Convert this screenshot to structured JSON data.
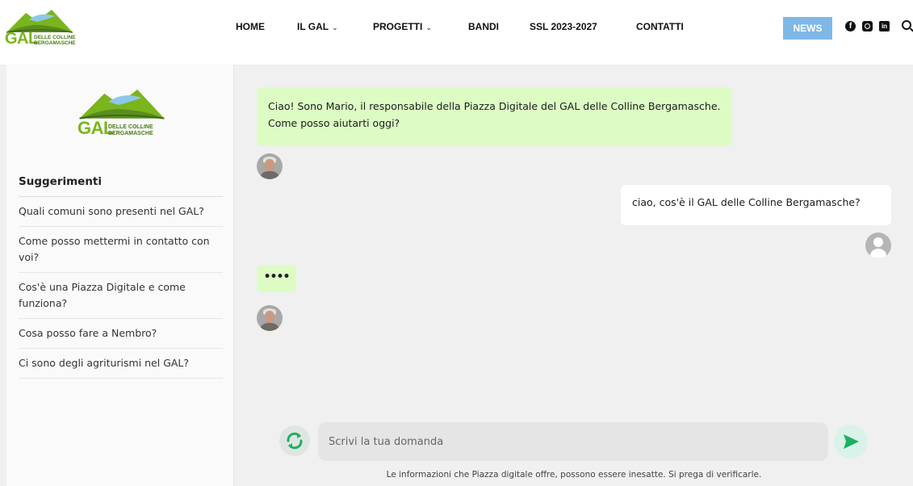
{
  "header": {
    "logo": {
      "main": "GAL",
      "sub_line1": "DELLE COLLINE",
      "sub_line2": "BERGAMASCHE"
    },
    "nav": [
      {
        "label": "HOME",
        "has_dropdown": false
      },
      {
        "label": "IL GAL",
        "has_dropdown": true
      },
      {
        "label": "PROGETTI",
        "has_dropdown": true
      },
      {
        "label": "BANDI",
        "has_dropdown": false
      },
      {
        "label": "SSL 2023-2027",
        "has_dropdown": false
      },
      {
        "label": "CONTATTI",
        "has_dropdown": false
      }
    ],
    "news_label": "NEWS",
    "chevron": "⌄",
    "social_icons": [
      "facebook-icon",
      "instagram-icon",
      "linkedin-icon"
    ],
    "search_icon": "search-icon",
    "accent_color": "#7fb8e6"
  },
  "sidebar": {
    "logo": {
      "main": "GAL",
      "sub_line1": "DELLE COLLINE",
      "sub_line2": "BERGAMASCHE"
    },
    "suggestions_title": "Suggerimenti",
    "suggestions": [
      "Quali comuni sono presenti nel GAL?",
      "Come posso mettermi in contatto con voi?",
      "Cos'è una Piazza Digitale e come funziona?",
      "Cosa posso fare a Nembro?",
      "Ci sono degli agriturismi nel GAL?"
    ]
  },
  "chat": {
    "messages": [
      {
        "role": "bot",
        "text": "Ciao! Sono Mario, il responsabile della Piazza Digitale del GAL delle Colline Bergamasche. Come posso aiutarti oggi?"
      },
      {
        "role": "user",
        "text": "ciao, cos'è il GAL delle Colline Bergamasche?"
      },
      {
        "role": "bot",
        "text": "••••"
      }
    ],
    "input_placeholder": "Scrivi la tua domanda",
    "input_value": "",
    "disclaimer": "Le informazioni che Piazza digitale offre, possono essere inesatte. Si prega di verificarle.",
    "bot_bubble_color": "#dcfcc4",
    "send_color": "#1fb060"
  }
}
